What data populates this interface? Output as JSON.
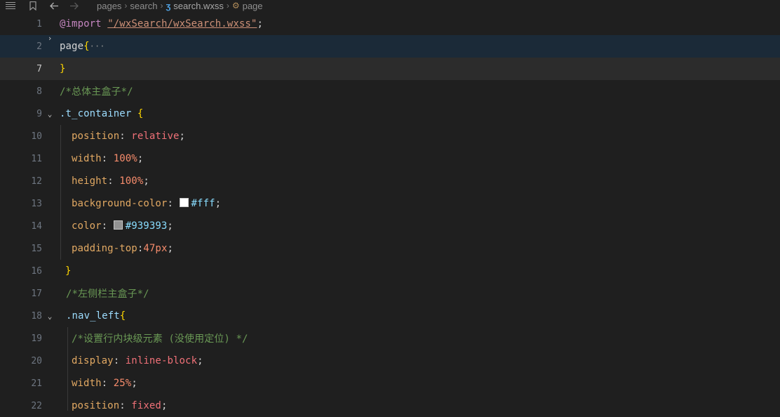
{
  "breadcrumb": {
    "items": [
      "pages",
      "search",
      "search.wxss",
      "page"
    ]
  },
  "colors": {
    "background": "#1f1f1f",
    "swatch_white": "#ffffff",
    "swatch_gray": "#939393"
  },
  "lines": [
    {
      "num": "1",
      "parts": [
        "@import",
        " ",
        "\"/wxSearch/wxSearch.wxss\"",
        ";"
      ]
    },
    {
      "num": "2",
      "parts": [
        "page",
        "{",
        "···"
      ]
    },
    {
      "num": "7",
      "parts": [
        "}"
      ]
    },
    {
      "num": "8",
      "parts": [
        "/*总体主盒子*/"
      ]
    },
    {
      "num": "9",
      "parts": [
        ".t_container",
        " ",
        "{"
      ]
    },
    {
      "num": "10",
      "parts": [
        "position",
        ": ",
        "relative",
        ";"
      ]
    },
    {
      "num": "11",
      "parts": [
        "width",
        ": ",
        "100%",
        ";"
      ]
    },
    {
      "num": "12",
      "parts": [
        "height",
        ": ",
        "100%",
        ";"
      ]
    },
    {
      "num": "13",
      "parts": [
        "background-color",
        ": ",
        "#fff",
        ";"
      ]
    },
    {
      "num": "14",
      "parts": [
        "color",
        ": ",
        "#939393",
        ";"
      ]
    },
    {
      "num": "15",
      "parts": [
        "padding-top",
        ":",
        "47px",
        ";"
      ]
    },
    {
      "num": "16",
      "parts": [
        "}"
      ]
    },
    {
      "num": "17",
      "parts": [
        "/*左侧栏主盒子*/"
      ]
    },
    {
      "num": "18",
      "parts": [
        ".nav_left",
        "{"
      ]
    },
    {
      "num": "19",
      "parts": [
        "/*设置行内块级元素 (没使用定位) */"
      ]
    },
    {
      "num": "20",
      "parts": [
        "display",
        ": ",
        "inline-block",
        ";"
      ]
    },
    {
      "num": "21",
      "parts": [
        "width",
        ": ",
        "25%",
        ";"
      ]
    },
    {
      "num": "22",
      "parts": [
        "position",
        ": ",
        "fixed",
        ";"
      ]
    }
  ]
}
